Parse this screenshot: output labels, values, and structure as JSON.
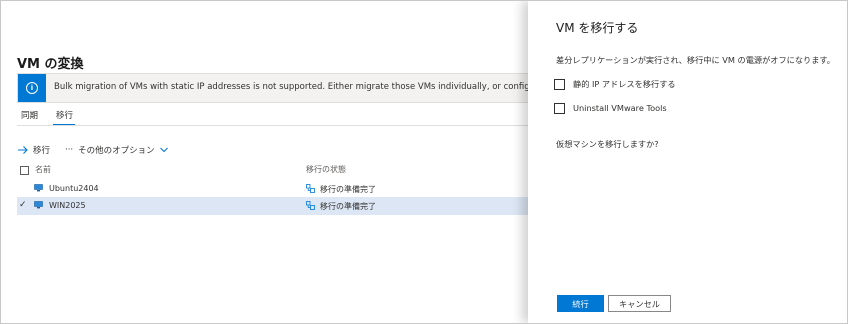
{
  "page": {
    "title": "VM の変換",
    "banner_text": "Bulk migration of VMs with static IP addresses is not supported. Either migrate those VMs individually, or configure them manually after mig"
  },
  "tabs": [
    {
      "label": "同期"
    },
    {
      "label": "移行"
    }
  ],
  "toolbar": {
    "migrate_label": "移行",
    "more_label": "その他のオプション"
  },
  "table": {
    "columns": [
      "名前",
      "移行の状態"
    ],
    "rows": [
      {
        "name": "Ubuntu2404",
        "status": "移行の準備完了",
        "selected": false
      },
      {
        "name": "WIN2025",
        "status": "移行の準備完了",
        "selected": true
      }
    ]
  },
  "panel": {
    "title": "VM を移行する",
    "description": "差分レプリケーションが実行され、移行中に VM の電源がオフになります。",
    "options": [
      {
        "label": "静的 IP アドレスを移行する",
        "checked": false
      },
      {
        "label": "Uninstall VMware Tools",
        "checked": false
      }
    ],
    "question": "仮想マシンを移行しますか?",
    "continue_label": "続行",
    "cancel_label": "キャンセル"
  },
  "colors": {
    "accent": "#0078d4",
    "selected_row": "#dce6f4"
  }
}
